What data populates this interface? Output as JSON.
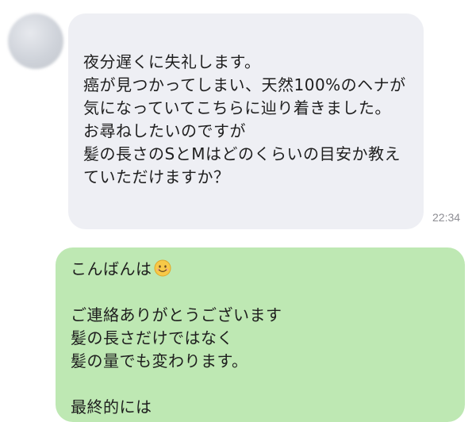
{
  "incoming": {
    "text": "夜分遅くに失礼します。\n癌が見つかってしまい、天然100%のヘナが気になっていてこちらに辿り着きました。\nお尋ねしたいのですが\n髪の長さのSとMはどのくらいの目安か教えていただけますか？",
    "time": "22:34"
  },
  "outgoing": {
    "line1": "こんばんは",
    "emoji": "smiling-face-emoji",
    "rest": "ご連絡ありがとうございます\n髪の長さだけではなく\n髪の量でも変わります。\n\n最終的には"
  },
  "colors": {
    "incoming_bubble": "#eeeff4",
    "outgoing_bubble": "#bee8b3",
    "timestamp": "#8d8d93"
  }
}
